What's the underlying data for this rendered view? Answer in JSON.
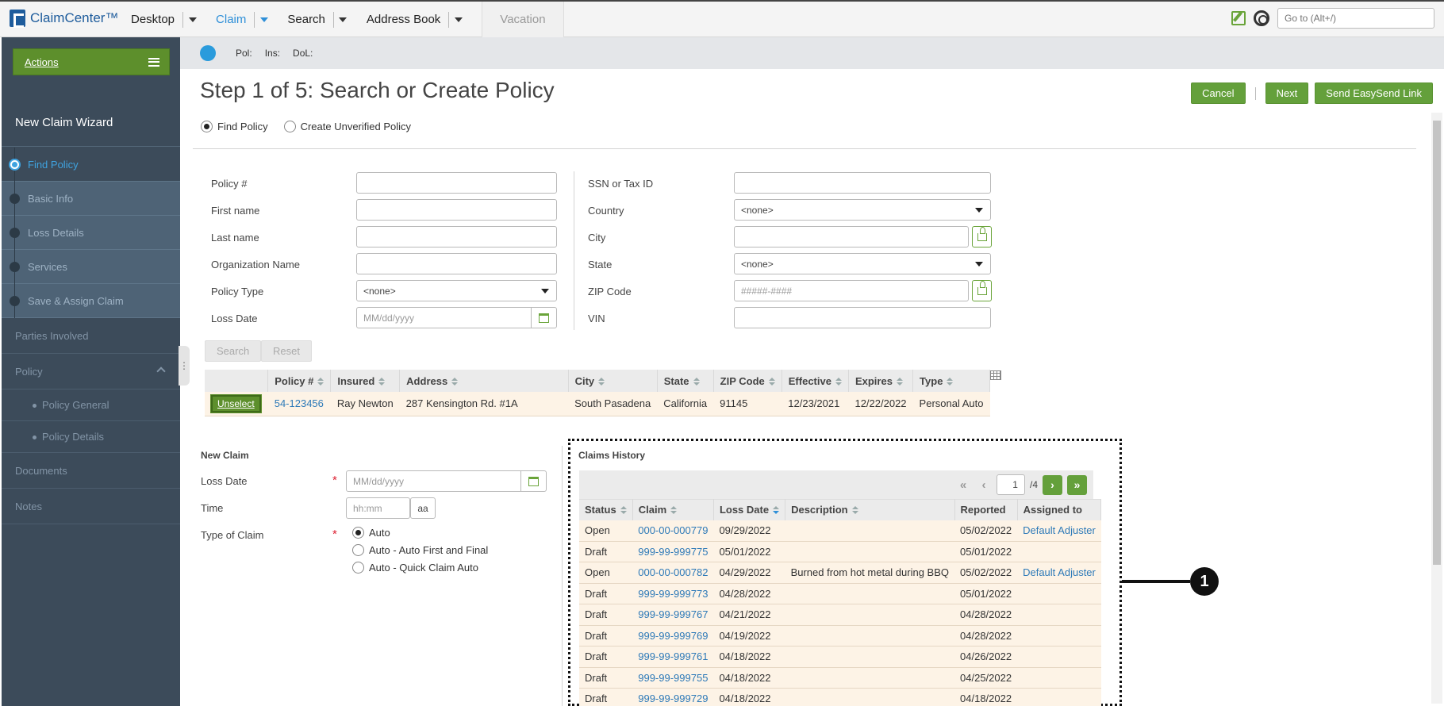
{
  "app": {
    "name": "ClaimCenter™"
  },
  "topnav": {
    "items": [
      {
        "label": "Desktop",
        "active": false
      },
      {
        "label": "Claim",
        "active": true
      },
      {
        "label": "Search",
        "active": false
      },
      {
        "label": "Address Book",
        "active": false
      }
    ],
    "vacation": "Vacation",
    "goto_placeholder": "Go to (Alt+/)"
  },
  "sidebar": {
    "actions_label": "Actions",
    "wizard_title": "New Claim Wizard",
    "steps": [
      "Find Policy",
      "Basic Info",
      "Loss Details",
      "Services",
      "Save & Assign Claim"
    ],
    "sections": {
      "parties": "Parties Involved",
      "policy": "Policy",
      "policy_general": "Policy General",
      "policy_details": "Policy Details",
      "documents": "Documents",
      "notes": "Notes"
    }
  },
  "infobar": {
    "pol": "Pol:",
    "ins": "Ins:",
    "dol": "DoL:"
  },
  "page": {
    "title": "Step 1 of 5: Search or Create Policy",
    "cancel": "Cancel",
    "next": "Next",
    "send_easysend": "Send EasySend Link"
  },
  "mode": {
    "find_policy": "Find Policy",
    "create_unverified": "Create Unverified Policy"
  },
  "search_form": {
    "policy_num": "Policy #",
    "first_name": "First name",
    "last_name": "Last name",
    "org_name": "Organization Name",
    "policy_type": "Policy Type",
    "policy_type_value": "<none>",
    "loss_date": "Loss Date",
    "date_placeholder": "MM/dd/yyyy",
    "ssn": "SSN or Tax ID",
    "country": "Country",
    "country_value": "<none>",
    "city": "City",
    "state": "State",
    "state_value": "<none>",
    "zip": "ZIP Code",
    "zip_placeholder": "#####-####",
    "vin": "VIN",
    "search_btn": "Search",
    "reset_btn": "Reset"
  },
  "policy_table": {
    "headers": [
      "Policy #",
      "Insured",
      "Address",
      "City",
      "State",
      "ZIP Code",
      "Effective",
      "Expires",
      "Type"
    ],
    "unselect": "Unselect",
    "row": {
      "policy": "54-123456",
      "insured": "Ray Newton",
      "address": "287 Kensington Rd. #1A",
      "city": "South Pasadena",
      "state": "California",
      "zip": "91145",
      "effective": "12/23/2021",
      "expires": "12/22/2022",
      "type": "Personal Auto"
    }
  },
  "new_claim": {
    "title": "New Claim",
    "loss_date": "Loss Date",
    "date_placeholder": "MM/dd/yyyy",
    "time": "Time",
    "time_placeholder": "hh:mm",
    "ampm": "aa",
    "type_label": "Type of Claim",
    "types": [
      "Auto",
      "Auto - Auto First and Final",
      "Auto - Quick Claim Auto"
    ],
    "required_mark": "*"
  },
  "claims_history": {
    "title": "Claims History",
    "page": "1",
    "page_total": "/4",
    "headers": [
      "Status",
      "Claim",
      "Loss Date",
      "Description",
      "Reported",
      "Assigned to"
    ],
    "rows": [
      {
        "status": "Open",
        "claim": "000-00-000779",
        "loss_date": "09/29/2022",
        "description": "",
        "reported": "05/02/2022",
        "assigned": "Default Adjuster"
      },
      {
        "status": "Draft",
        "claim": "999-99-999775",
        "loss_date": "05/01/2022",
        "description": "",
        "reported": "05/01/2022",
        "assigned": ""
      },
      {
        "status": "Open",
        "claim": "000-00-000782",
        "loss_date": "04/29/2022",
        "description": "Burned from hot metal during BBQ",
        "reported": "05/02/2022",
        "assigned": "Default Adjuster"
      },
      {
        "status": "Draft",
        "claim": "999-99-999773",
        "loss_date": "04/28/2022",
        "description": "",
        "reported": "05/01/2022",
        "assigned": ""
      },
      {
        "status": "Draft",
        "claim": "999-99-999767",
        "loss_date": "04/21/2022",
        "description": "",
        "reported": "04/28/2022",
        "assigned": ""
      },
      {
        "status": "Draft",
        "claim": "999-99-999769",
        "loss_date": "04/19/2022",
        "description": "",
        "reported": "04/28/2022",
        "assigned": ""
      },
      {
        "status": "Draft",
        "claim": "999-99-999761",
        "loss_date": "04/18/2022",
        "description": "",
        "reported": "04/26/2022",
        "assigned": ""
      },
      {
        "status": "Draft",
        "claim": "999-99-999755",
        "loss_date": "04/18/2022",
        "description": "",
        "reported": "04/25/2022",
        "assigned": ""
      },
      {
        "status": "Draft",
        "claim": "999-99-999729",
        "loss_date": "04/18/2022",
        "description": "",
        "reported": "04/18/2022",
        "assigned": ""
      }
    ]
  },
  "callout": {
    "number": "1"
  }
}
